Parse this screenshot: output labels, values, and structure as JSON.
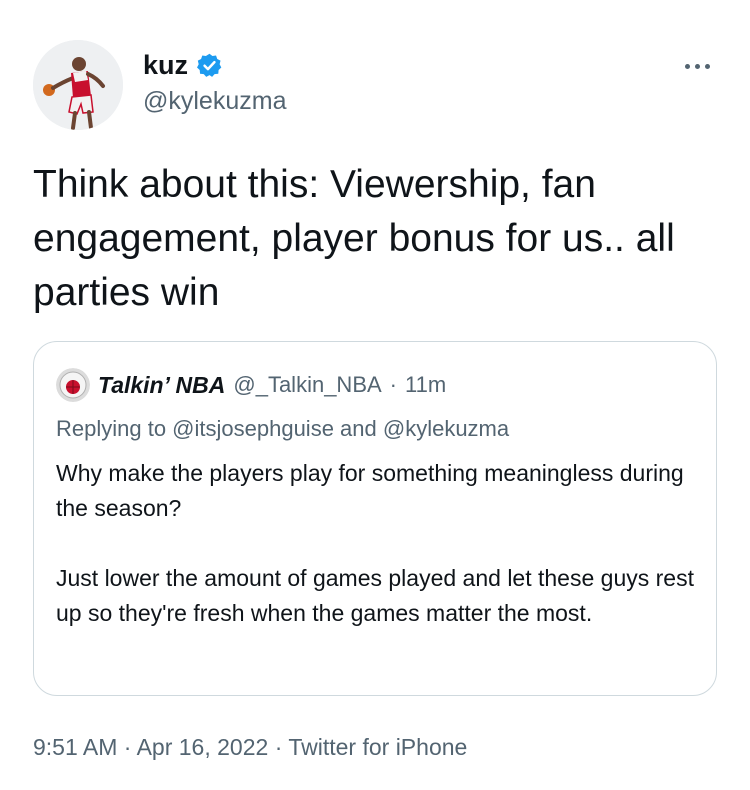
{
  "author": {
    "display_name": "kuz",
    "handle": "@kylekuzma",
    "verified": true,
    "avatar_icon": "player-avatar-icon"
  },
  "tweet": {
    "text": "Think about this: Viewership, fan engagement, player bonus for us.. all parties win"
  },
  "quoted_tweet": {
    "display_name": "Talkin’ NBA",
    "handle": "@_Talkin_NBA",
    "separator": "·",
    "time": "11m",
    "replying_to": "Replying to @itsjosephguise and @kylekuzma",
    "text": "Why make the players play for something meaningless during the season?\n\nJust lower the amount of games played and let these guys rest up so they're fresh when the games matter the most."
  },
  "meta": {
    "time": "9:51 AM",
    "sep1": "·",
    "date": "Apr 16, 2022",
    "sep2": "·",
    "source": "Twitter for iPhone"
  },
  "colors": {
    "verified_blue": "#1d9bf0",
    "secondary_text": "#536471",
    "primary_text": "#0f1419",
    "border": "#cfd9de"
  }
}
